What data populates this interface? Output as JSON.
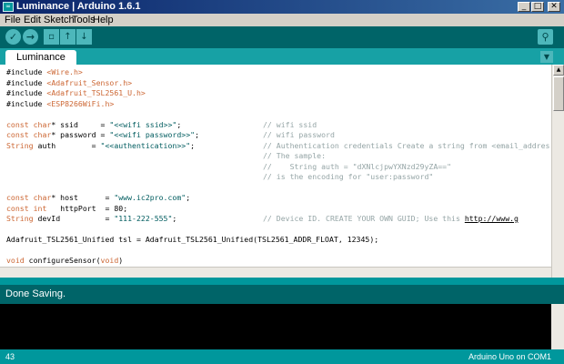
{
  "window": {
    "title": "Luminance | Arduino 1.6.1",
    "app_icon": "arduino-infinity-icon",
    "controls": [
      "minimize-icon",
      "maximize-icon",
      "close-icon"
    ]
  },
  "menu": [
    "File",
    "Edit",
    "Sketch",
    "Tools",
    "Help"
  ],
  "toolbar": {
    "buttons": [
      "verify-icon",
      "upload-icon",
      "new-icon",
      "open-icon",
      "save-icon"
    ],
    "search": "serial-monitor-icon"
  },
  "tabs": [
    "Luminance"
  ],
  "editor": {
    "lines": [
      {
        "code": "#include <Wire.h>",
        "comment": ""
      },
      {
        "code": "#include <Adafruit_Sensor.h>",
        "comment": ""
      },
      {
        "code": "#include <Adafruit_TSL2561_U.h>",
        "comment": ""
      },
      {
        "code": "#include <ESP8266WiFi.h>",
        "comment": ""
      },
      {
        "code": "",
        "comment": ""
      },
      {
        "code": "const char* ssid     = \"<<wifi ssid>>\";",
        "comment": "// wifi ssid"
      },
      {
        "code": "const char* password = \"<<wifi password>>\";",
        "comment": "// wifi password"
      },
      {
        "code": "String auth        = \"<<authentication>>\";",
        "comment": "// Authentication credentials Create a string from <email_address>:"
      },
      {
        "code": "",
        "comment": "// The sample:"
      },
      {
        "code": "",
        "comment": "//    String auth = \"dXNlcjpwYXNzd29yZA==\""
      },
      {
        "code": "",
        "comment": "// is the encoding for \"user:password\""
      },
      {
        "code": "",
        "comment": ""
      },
      {
        "code": "const char* host      = \"www.ic2pro.com\";",
        "comment": ""
      },
      {
        "code": "const int   httpPort  = 80;",
        "comment": ""
      },
      {
        "code": "String devId          = \"111-222-555\";",
        "comment": "// Device ID. CREATE YOUR OWN GUID; Use this http://www.g"
      },
      {
        "code": "",
        "comment": ""
      },
      {
        "code": "Adafruit_TSL2561_Unified tsl = Adafruit_TSL2561_Unified(TSL2561_ADDR_FLOAT, 12345);",
        "comment": ""
      },
      {
        "code": "",
        "comment": ""
      },
      {
        "code": "void configureSensor(void)",
        "comment": ""
      },
      {
        "code": "{",
        "comment": ""
      }
    ]
  },
  "status": {
    "message": "Done Saving.",
    "line_number": "43",
    "board": "Arduino Uno on COM1"
  },
  "colors": {
    "toolbar": "#006468",
    "tabbar": "#17a1a5",
    "footer": "#00979c",
    "keyword": "#cc6633",
    "comment": "#95a5a6"
  }
}
